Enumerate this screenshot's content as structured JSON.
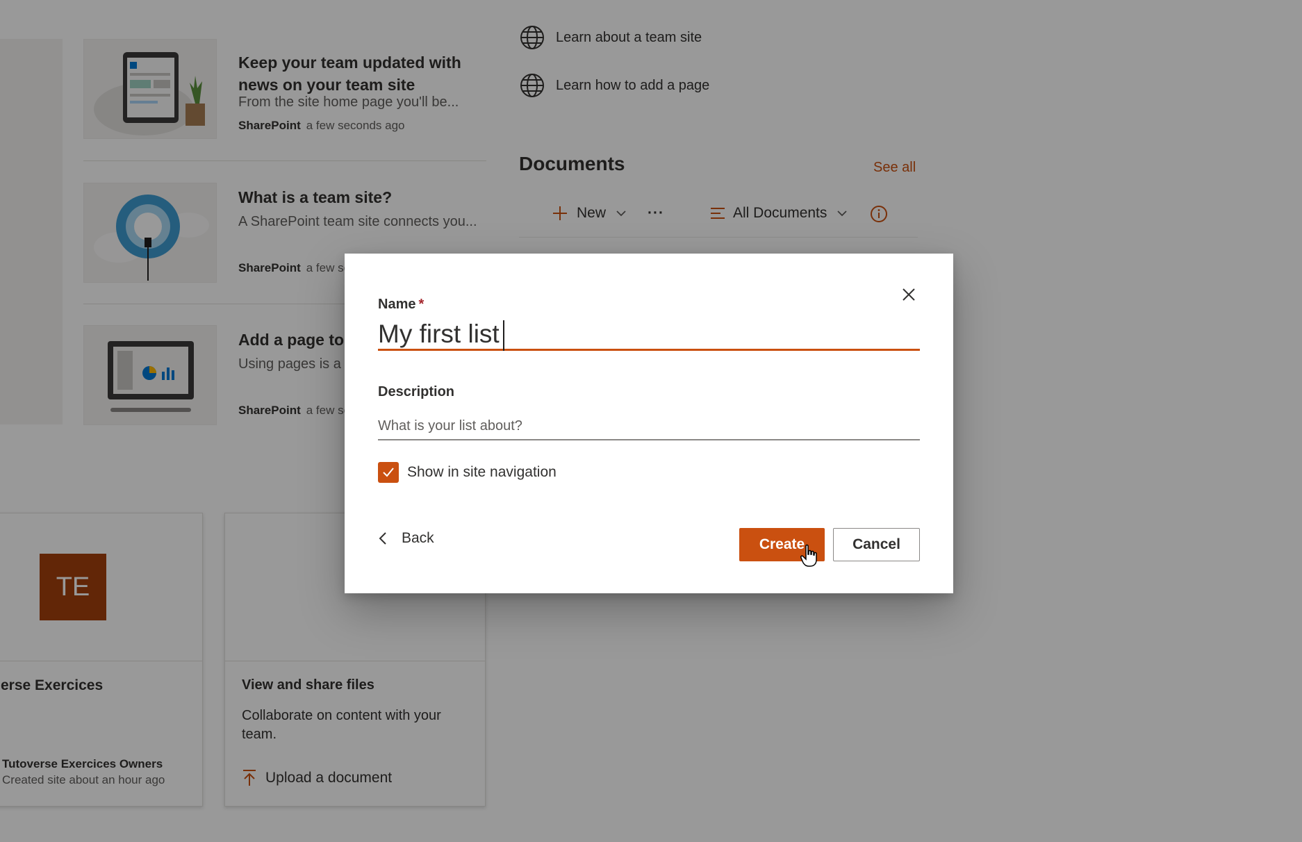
{
  "news": [
    {
      "title": "Keep your team updated with news on your team site",
      "description": "From the site home page you'll be...",
      "source": "SharePoint",
      "time": "a few seconds ago"
    },
    {
      "title": "What is a team site?",
      "description": "A SharePoint team site connects you...",
      "source": "SharePoint",
      "time": "a few se"
    },
    {
      "title": "Add a page to",
      "description": "Using pages is a",
      "source": "SharePoint",
      "time": "a few se"
    }
  ],
  "quick_links": [
    {
      "label": "Learn about a team site",
      "icon": "globe-icon"
    },
    {
      "label": "Learn how to add a page",
      "icon": "globe-icon"
    }
  ],
  "documents": {
    "title": "Documents",
    "see_all": "See all",
    "new_label": "New",
    "more_label": "···",
    "view_label": "All Documents"
  },
  "site_card": {
    "initials": "TE",
    "title": "erse Exercices",
    "owner": "Tutoverse Exercices Owners",
    "activity": "Created site about an hour ago"
  },
  "files_card": {
    "title": "View and share files",
    "description": "Collaborate on content with your team.",
    "action": "Upload a document"
  },
  "dialog": {
    "name_label": "Name",
    "required_mark": "*",
    "name_value": "My first list",
    "description_label": "Description",
    "description_placeholder": "What is your list about?",
    "show_in_nav_label": "Show in site navigation",
    "show_in_nav_checked": true,
    "back_label": "Back",
    "create_label": "Create",
    "cancel_label": "Cancel"
  },
  "colors": {
    "accent": "#ca5010",
    "site_logo_bg": "#a4400c",
    "overlay": "rgba(0,0,0,0.4)"
  }
}
